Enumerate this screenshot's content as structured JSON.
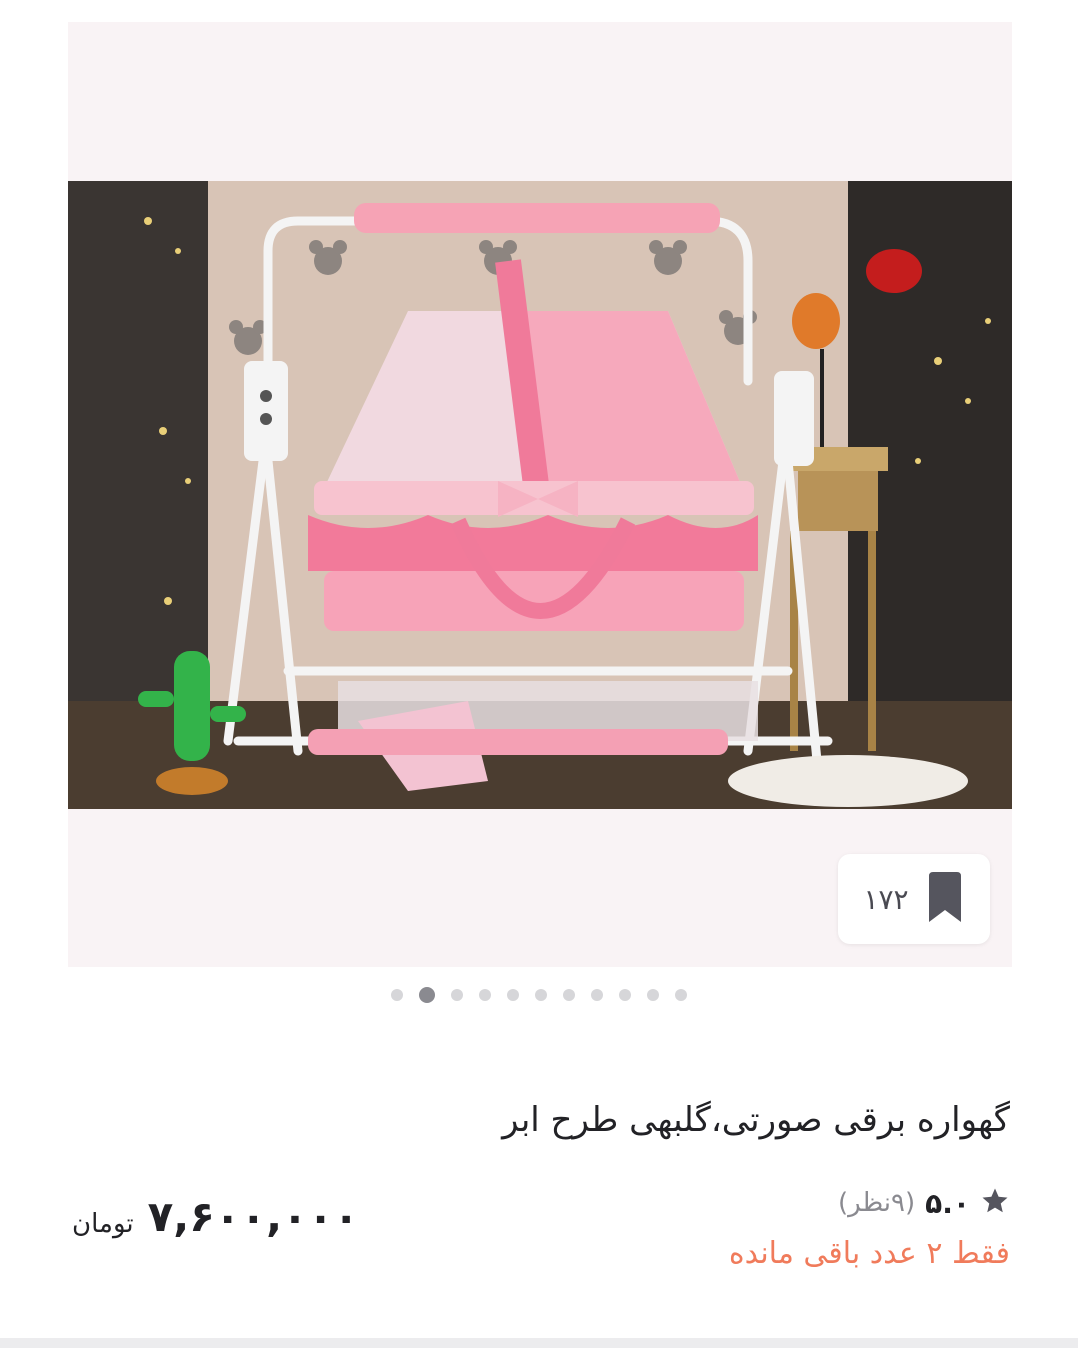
{
  "gallery": {
    "bookmark_count": "۱۷۲",
    "dots_total": 11,
    "active_index": 1
  },
  "product": {
    "title": "گهواره برقی صورتی،گلبهی طرح ابر",
    "rating_value": "۵.۰",
    "rating_count": "(۹نظر)",
    "stock_note": "فقط ۲ عدد باقی مانده",
    "price": "۷,۶۰۰,۰۰۰",
    "currency": "تومان"
  },
  "colors": {
    "stock_accent": "#f07b5b",
    "gallery_bg": "#f9f3f5",
    "cradle_pink": "#f48aa8"
  },
  "icons": {
    "bookmark": "bookmark-icon",
    "star": "star-icon"
  }
}
